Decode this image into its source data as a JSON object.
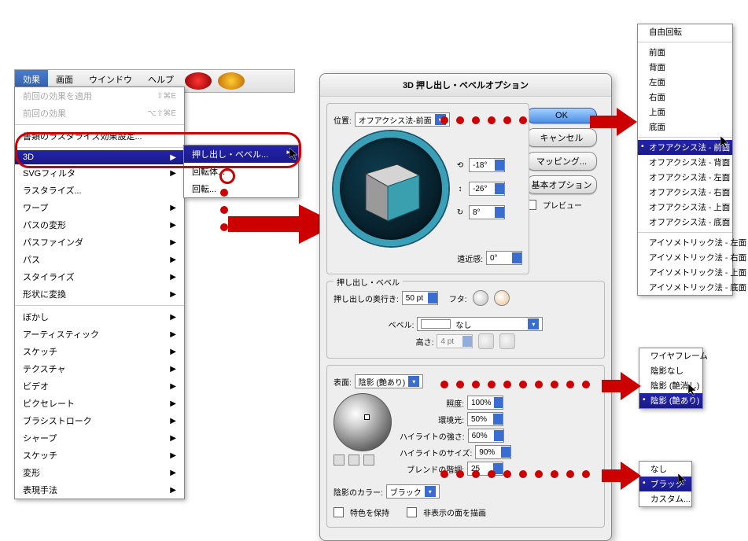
{
  "menubar": {
    "items": [
      "効果",
      "画面",
      "ウインドウ",
      "ヘルプ"
    ]
  },
  "dropdown": {
    "apply_last": "前回の効果を適用",
    "apply_last_key": "⇧⌘E",
    "last_effect": "前回の効果",
    "last_effect_key": "⌥⇧⌘E",
    "rasterize_settings": "書類のラスタライズ効果設定...",
    "three_d": "3D",
    "svg_filter": "SVGフィルタ",
    "rasterize": "ラスタライズ...",
    "warp": "ワープ",
    "distort": "パスの変形",
    "pathfinder": "パスファインダ",
    "path": "パス",
    "stylize": "スタイライズ",
    "convert_shape": "形状に変換",
    "blur": "ぼかし",
    "artistic": "アーティスティック",
    "sketch_jp": "スケッチ",
    "texture": "テクスチャ",
    "video": "ビデオ",
    "pixelate": "ピクセレート",
    "brush": "ブラシストローク",
    "sharpen": "シャープ",
    "stylize2": "スケッチ",
    "distort2": "変形",
    "render": "表現手法"
  },
  "submenu": {
    "extrude": "押し出し・ベベル...",
    "revolve": "回転体...",
    "rotate": "回転..."
  },
  "dialog": {
    "title": "3D 押し出し・ベベルオプション",
    "position_label": "位置:",
    "position_value": "オフアクシス法-前面",
    "angle_x": "-18°",
    "angle_y": "-26°",
    "angle_z": "8°",
    "perspective_label": "遠近感:",
    "perspective_value": "0°",
    "extrude_group": "押し出し・ベベル",
    "extrude_depth_label": "押し出しの奥行き:",
    "extrude_depth_value": "50 pt",
    "cap_label": "フタ:",
    "bevel_label": "ベベル:",
    "bevel_value": "なし",
    "height_label": "高さ:",
    "height_value": "4 pt",
    "surface_label": "表面:",
    "surface_value": "陰影 (艶あり)",
    "intensity_label": "照度:",
    "intensity_value": "100%",
    "ambient_label": "環境光:",
    "ambient_value": "50%",
    "highlight_int_label": "ハイライトの強さ:",
    "highlight_int_value": "60%",
    "highlight_size_label": "ハイライトのサイズ:",
    "highlight_size_value": "90%",
    "blend_label": "ブレンドの階調:",
    "blend_value": "25",
    "shade_color_label": "陰影のカラー:",
    "shade_color_value": "ブラック",
    "preserve_spot": "特色を保持",
    "draw_hidden": "非表示の面を描画",
    "ok": "OK",
    "cancel": "キャンセル",
    "map_art": "マッピング...",
    "more": "基本オプション",
    "preview": "プレビュー"
  },
  "popup_position": {
    "free": "自由回転",
    "front": "前面",
    "back": "背面",
    "left": "左面",
    "right": "右面",
    "top": "上面",
    "bottom": "底面",
    "off_front": "オフアクシス法 - 前面",
    "off_back": "オフアクシス法 - 背面",
    "off_left": "オフアクシス法 - 左面",
    "off_right": "オフアクシス法 - 右面",
    "off_top": "オフアクシス法 - 上面",
    "off_bottom": "オフアクシス法 - 底面",
    "iso_left": "アイソメトリック法 - 左面",
    "iso_right": "アイソメトリック法 - 右面",
    "iso_top": "アイソメトリック法 - 上面",
    "iso_bottom": "アイソメトリック法 - 底面"
  },
  "popup_surface": {
    "wireframe": "ワイヤフレーム",
    "no_shading": "陰影なし",
    "diffuse": "陰影 (艶消し)",
    "plastic": "陰影 (艶あり)"
  },
  "popup_color": {
    "none": "なし",
    "black": "ブラック",
    "custom": "カスタム..."
  }
}
